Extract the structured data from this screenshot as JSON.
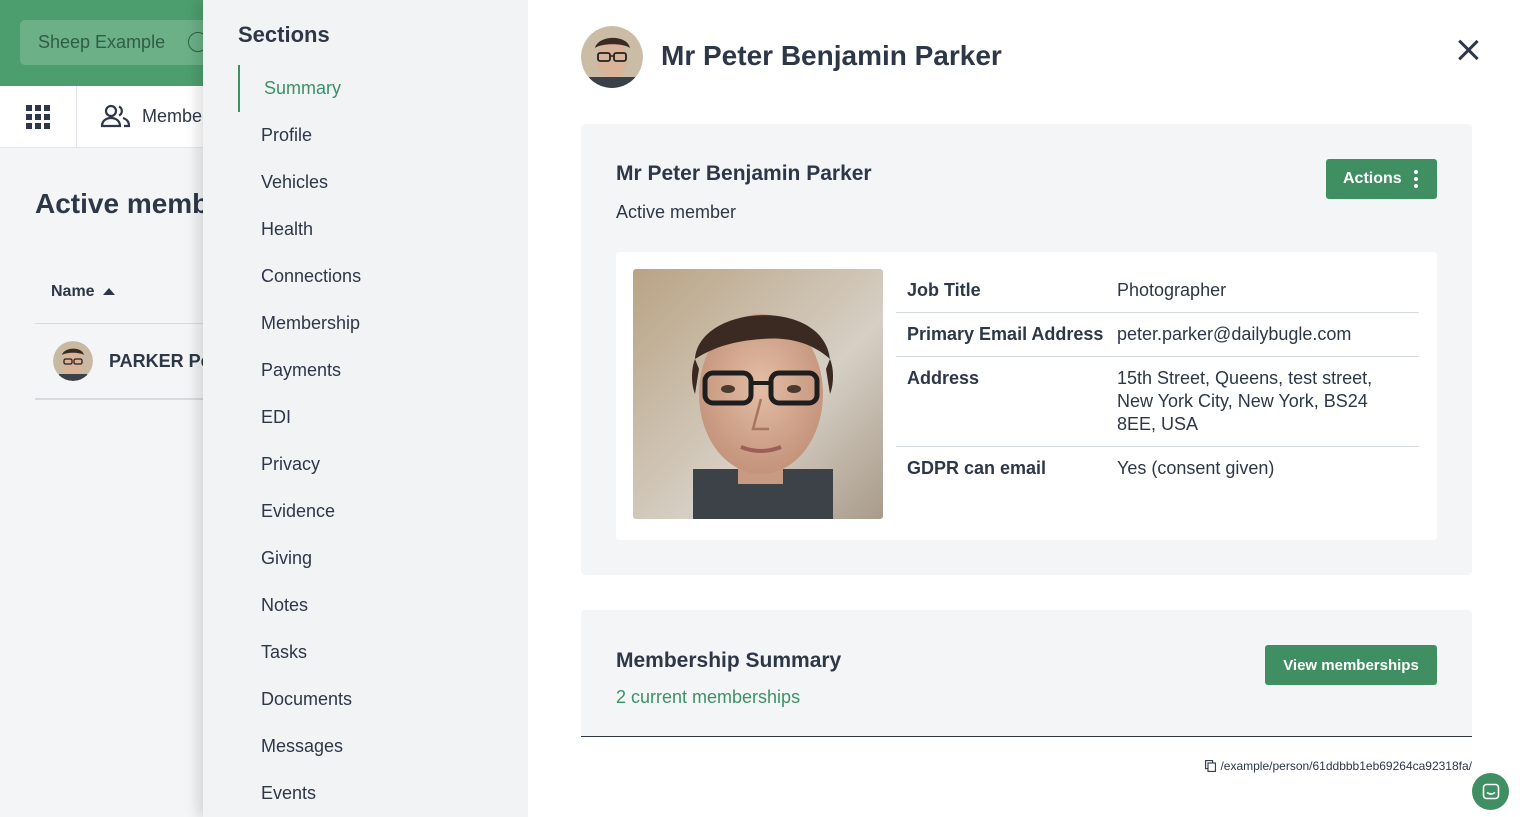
{
  "background": {
    "org_name": "Sheep Example",
    "nav_tab": "Members",
    "page_title": "Active members",
    "table_header_name": "Name",
    "row_name": "PARKER Peter"
  },
  "sections": {
    "title": "Sections",
    "items": [
      {
        "label": "Summary",
        "active": true
      },
      {
        "label": "Profile"
      },
      {
        "label": "Vehicles"
      },
      {
        "label": "Health"
      },
      {
        "label": "Connections"
      },
      {
        "label": "Membership"
      },
      {
        "label": "Payments"
      },
      {
        "label": "EDI"
      },
      {
        "label": "Privacy"
      },
      {
        "label": "Evidence"
      },
      {
        "label": "Giving"
      },
      {
        "label": "Notes"
      },
      {
        "label": "Tasks"
      },
      {
        "label": "Documents"
      },
      {
        "label": "Messages"
      },
      {
        "label": "Events"
      }
    ]
  },
  "header": {
    "name": "Mr Peter Benjamin Parker"
  },
  "summary": {
    "name": "Mr Peter Benjamin Parker",
    "status": "Active member",
    "actions_label": "Actions",
    "details": [
      {
        "label": "Job Title",
        "value": "Photographer"
      },
      {
        "label": "Primary Email Address",
        "value": "peter.parker@dailybugle.com"
      },
      {
        "label": "Address",
        "value": "15th Street, Queens, test street, New York City, New York, BS24 8EE, USA"
      },
      {
        "label": "GDPR can email",
        "value": "Yes (consent given)"
      }
    ]
  },
  "membership_summary": {
    "title": "Membership Summary",
    "count_text": "2 current memberships",
    "button_label": "View memberships"
  },
  "footer": {
    "path": "/example/person/61ddbbb1eb69264ca92318fa/"
  },
  "colors": {
    "brand_green": "#3f8f62",
    "topbar_green": "#4d9e6e",
    "accent_text": "#3d9166"
  }
}
